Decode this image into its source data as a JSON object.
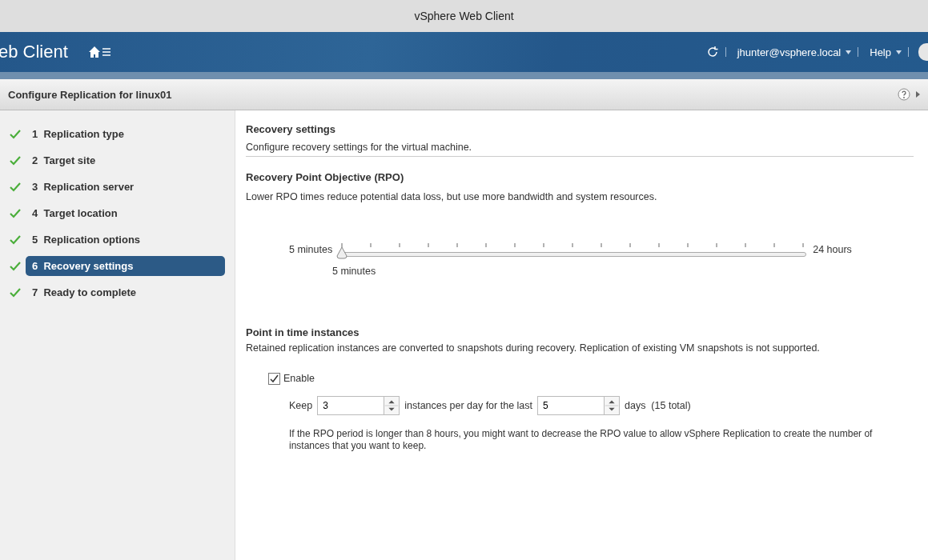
{
  "window": {
    "title": "vSphere Web Client"
  },
  "header": {
    "brand": "eb Client",
    "user": "jhunter@vsphere.local",
    "help": "Help"
  },
  "dialog": {
    "title": "Configure Replication for linux01"
  },
  "steps": [
    {
      "label": "1  Replication type",
      "done": true,
      "selected": false
    },
    {
      "label": "2  Target site",
      "done": true,
      "selected": false
    },
    {
      "label": "3  Replication server",
      "done": true,
      "selected": false
    },
    {
      "label": "4  Target location",
      "done": true,
      "selected": false
    },
    {
      "label": "5  Replication options",
      "done": true,
      "selected": false
    },
    {
      "label": "6  Recovery settings",
      "done": true,
      "selected": true
    },
    {
      "label": "7  Ready to complete",
      "done": true,
      "selected": false
    }
  ],
  "page": {
    "title": "Recovery settings",
    "subtitle": "Configure recovery settings for the virtual machine."
  },
  "rpo": {
    "title": "Recovery Point Objective (RPO)",
    "description": "Lower RPO times reduce potential data loss, but use more bandwidth and system resources.",
    "min_label": "5 minutes",
    "max_label": "24 hours",
    "level": 0,
    "value": "5 minutes"
  },
  "pit": {
    "title": "Point in time instances",
    "description": "Retained replication instances are converted to snapshots during recovery. Replication of existing VM snapshots is not supported.",
    "enable_label": "Enable",
    "enabled": true,
    "keep_label": "Keep",
    "instances": "3",
    "per_day_label": "instances per day for the last",
    "days": "5",
    "days_label": "days  (15 total)",
    "note": "If the RPO period is longer than 8 hours, you might want to decrease the RPO value to allow vSphere Replication to create the number of instances that you want to keep."
  }
}
